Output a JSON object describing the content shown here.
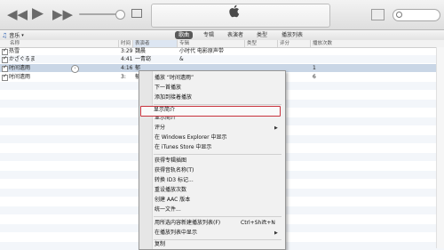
{
  "search": {
    "placeholder": ""
  },
  "nav": {
    "source": "音乐",
    "tabs": [
      "歌曲",
      "专辑",
      "表演者",
      "类型",
      "播放列表"
    ]
  },
  "table": {
    "headers": [
      "名称",
      "时间",
      "表演者",
      "专辑",
      "类型",
      "评分",
      "播放次数"
    ],
    "rows": [
      {
        "name": "热雪",
        "time": "3:29",
        "artist": "魏晨",
        "album": "小时代 电影原声带",
        "plays": ""
      },
      {
        "name": "かざぐるま",
        "time": "4:41",
        "artist": "一青窈",
        "album": "&",
        "plays": ""
      },
      {
        "name": "时间遗雨",
        "time": "4:16",
        "artist": "郁",
        "album": "",
        "plays": "1"
      },
      {
        "name": "时间遗雨",
        "time": "3:",
        "artist": "郁",
        "album": "",
        "plays": "6"
      }
    ]
  },
  "menu": {
    "items": [
      {
        "label": "播放 “时间遗雨”",
        "shortcut": ""
      },
      {
        "label": "下一首播放",
        "shortcut": ""
      },
      {
        "label": "添加到接着播放",
        "shortcut": ""
      },
      {
        "label": "显示简介",
        "shortcut": ""
      },
      {
        "label": "评分",
        "shortcut": ""
      },
      {
        "label": "在 Windows Explorer 中显示",
        "shortcut": ""
      },
      {
        "label": "在 iTunes Store 中显示",
        "shortcut": ""
      },
      {
        "label": "获得专辑插图",
        "shortcut": ""
      },
      {
        "label": "获得音轨名称(T)",
        "shortcut": ""
      },
      {
        "label": "转换 ID3 标记...",
        "shortcut": ""
      },
      {
        "label": "重设播放次数",
        "shortcut": ""
      },
      {
        "label": "创建 AAC 版本",
        "shortcut": ""
      },
      {
        "label": "统一文件...",
        "shortcut": ""
      },
      {
        "label": "用所选内容新建播放列表(F)",
        "shortcut": "Ctrl+Shift+N"
      },
      {
        "label": "在播放列表中显示",
        "shortcut": ""
      },
      {
        "label": "复制",
        "shortcut": ""
      }
    ]
  }
}
